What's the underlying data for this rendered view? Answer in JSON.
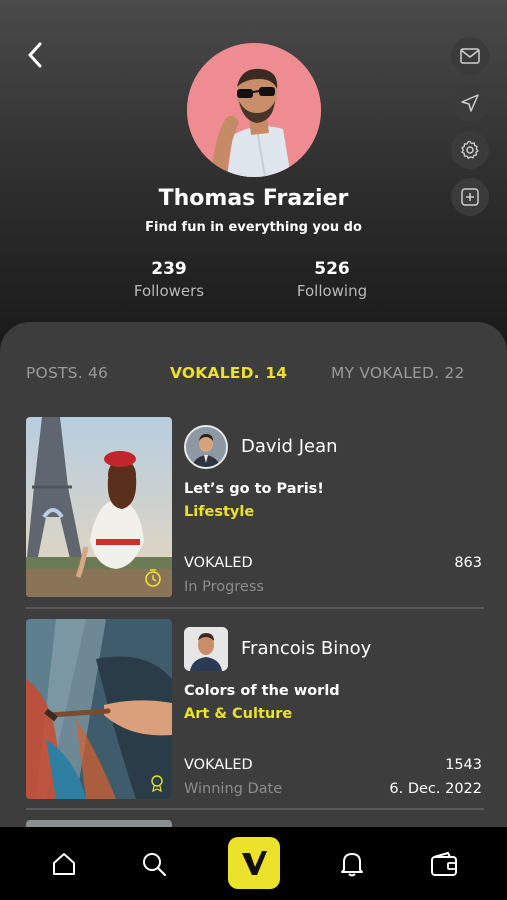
{
  "profile": {
    "name": "Thomas Frazier",
    "bio": "Find fun in everything you do",
    "followers_count": "239",
    "followers_label": "Followers",
    "following_count": "526",
    "following_label": "Following"
  },
  "header_icons": [
    "back-arrow-icon",
    "mail-icon",
    "send-icon",
    "settings-icon",
    "add-icon"
  ],
  "tabs": [
    {
      "label": "POSTS. 46",
      "active": false
    },
    {
      "label": "VOKALED. 14",
      "active": true
    },
    {
      "label": "MY VOKALED. 22",
      "active": false
    }
  ],
  "cards": [
    {
      "user": "David Jean",
      "title": "Let’s go to Paris!",
      "category": "Lifestyle",
      "status_label": "VOKALED",
      "status_value": "863",
      "sub_label": "In Progress",
      "sub_value": ""
    },
    {
      "user": "Francois Binoy",
      "title": "Colors of the world",
      "category": "Art & Culture",
      "status_label": "VOKALED",
      "status_value": "1543",
      "sub_label": "Winning Date",
      "sub_value": "6. Dec. 2022"
    }
  ],
  "nav": [
    "home-icon",
    "search-icon",
    "vokal-logo-icon",
    "bell-icon",
    "wallet-icon"
  ],
  "colors": {
    "accent": "#ece12b",
    "panel": "#3d3d3d",
    "nav": "#000000",
    "avatar_bg": "#ee8c92"
  }
}
